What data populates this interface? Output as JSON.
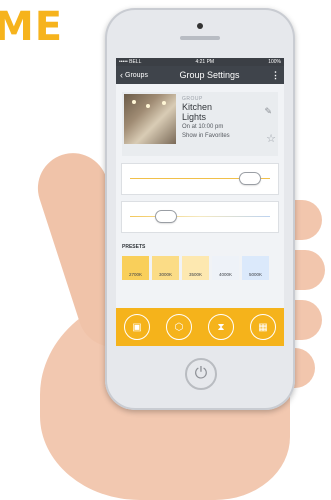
{
  "brand": {
    "text": "ME",
    "tm": "™",
    "color": "#f6b31c"
  },
  "status_bar": {
    "carrier": "••••• BELL",
    "time": "4:21 PM",
    "battery": "100%"
  },
  "nav": {
    "back_label": "Groups",
    "title": "Group Settings"
  },
  "group": {
    "type_label": "GROUP",
    "name_line1": "Kitchen",
    "name_line2": "Lights",
    "schedule": "On at 10:00 pm",
    "favorites_label": "Show in Favorites"
  },
  "sliders": {
    "brightness_fraction": 0.92,
    "color_temp_fraction": 0.22
  },
  "presets": {
    "label": "PRESETS",
    "items": [
      {
        "label": "2700K",
        "color": "#f9cf5a"
      },
      {
        "label": "3000K",
        "color": "#fbdc86"
      },
      {
        "label": "3500K",
        "color": "#fde8b0"
      },
      {
        "label": "4000K",
        "color": "#eef2f8"
      },
      {
        "label": "5000K",
        "color": "#dbe9fb"
      }
    ]
  },
  "tabs": [
    {
      "icon": "bulb-dimmer-icon"
    },
    {
      "icon": "group-icon"
    },
    {
      "icon": "timer-icon"
    },
    {
      "icon": "schedule-calendar-icon"
    }
  ],
  "accent_color": "#f5b31b"
}
